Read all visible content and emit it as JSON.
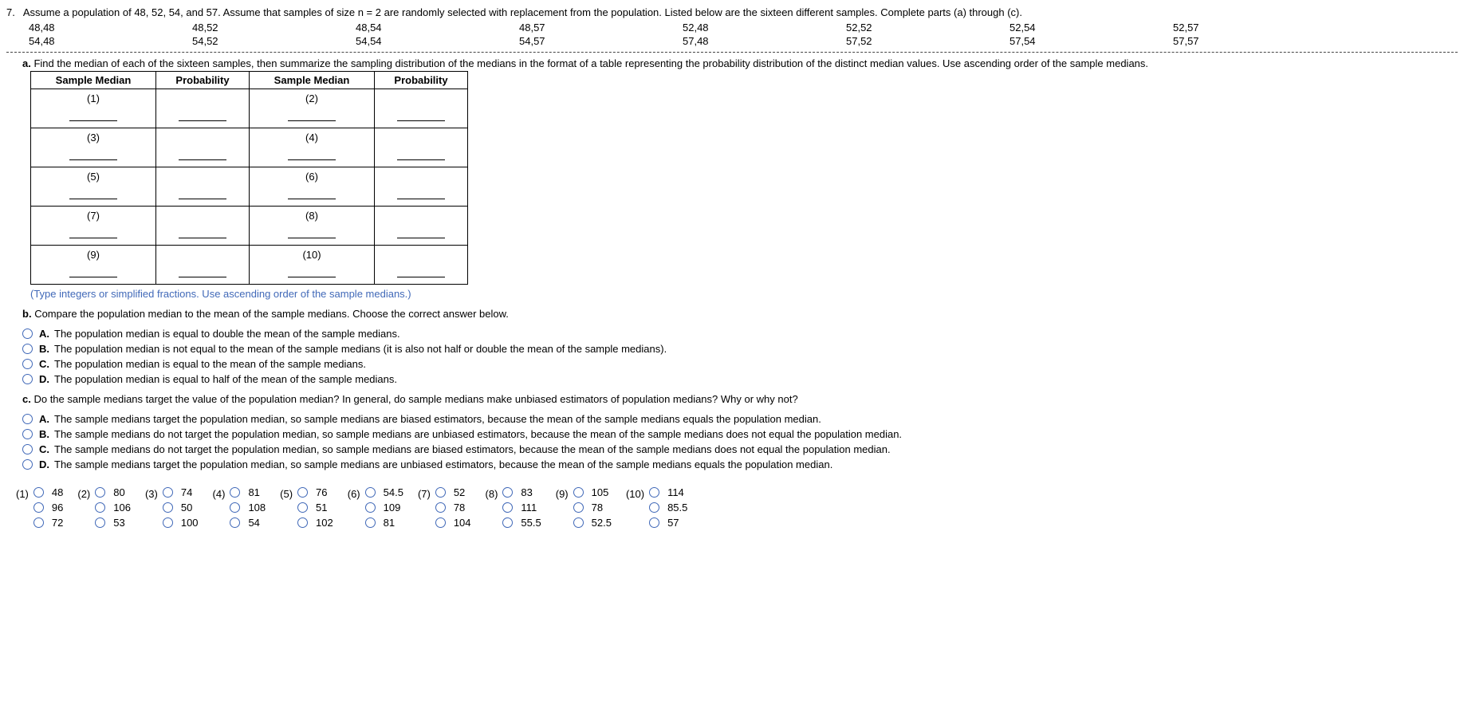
{
  "question": {
    "number": "7.",
    "intro": "Assume a population of 48, 52, 54, and 57. Assume that samples of size n = 2 are randomly selected with replacement from the population. Listed below are the sixteen different samples. Complete parts (a) through (c)."
  },
  "samples": {
    "row1": [
      "48,48",
      "48,52",
      "48,54",
      "48,57",
      "52,48",
      "52,52",
      "52,54",
      "52,57"
    ],
    "row2": [
      "54,48",
      "54,52",
      "54,54",
      "54,57",
      "57,48",
      "57,52",
      "57,54",
      "57,57"
    ]
  },
  "partA": {
    "label": "a.",
    "text": "Find the median of each of the sixteen samples, then summarize the sampling distribution of the medians in the format of a table representing the probability distribution of the distinct median values. Use ascending order of the sample medians.",
    "headers": [
      "Sample Median",
      "Probability",
      "Sample Median",
      "Probability"
    ],
    "rows": [
      "(1)",
      "(2)",
      "(3)",
      "(4)",
      "(5)",
      "(6)",
      "(7)",
      "(8)",
      "(9)",
      "(10)"
    ],
    "note": "(Type integers or simplified fractions. Use ascending order of the sample medians.)"
  },
  "partB": {
    "label": "b.",
    "text": "Compare the population median to the mean of the sample medians. Choose the correct answer below.",
    "options": [
      {
        "label": "A.",
        "text": "The population median is equal to double the mean of the sample medians."
      },
      {
        "label": "B.",
        "text": "The population median is not equal to the mean of the sample medians (it is also not half or double the mean of the sample medians)."
      },
      {
        "label": "C.",
        "text": "The population median is equal to the mean of the sample medians."
      },
      {
        "label": "D.",
        "text": "The population median is equal to half of the mean of the sample medians."
      }
    ]
  },
  "partC": {
    "label": "c.",
    "text": "Do the sample medians target the value of the population median? In general, do sample medians make unbiased estimators of population medians? Why or why not?",
    "options": [
      {
        "label": "A.",
        "text": "The sample medians target the population median, so sample medians are biased estimators, because the mean of the sample medians equals the population median."
      },
      {
        "label": "B.",
        "text": "The sample medians do not target the population median, so sample medians are unbiased estimators, because the mean of the sample medians does not equal the population median."
      },
      {
        "label": "C.",
        "text": "The sample medians do not target the population median, so sample medians are biased estimators, because the mean of the sample medians does not equal the population median."
      },
      {
        "label": "D.",
        "text": "The sample medians target the population median, so sample medians are unbiased estimators, because the mean of the sample medians equals the population median."
      }
    ]
  },
  "answers": [
    {
      "num": "(1)",
      "opts": [
        "48",
        "96",
        "72"
      ]
    },
    {
      "num": "(2)",
      "opts": [
        "80",
        "106",
        "53"
      ]
    },
    {
      "num": "(3)",
      "opts": [
        "74",
        "50",
        "100"
      ]
    },
    {
      "num": "(4)",
      "opts": [
        "81",
        "108",
        "54"
      ]
    },
    {
      "num": "(5)",
      "opts": [
        "76",
        "51",
        "102"
      ]
    },
    {
      "num": "(6)",
      "opts": [
        "54.5",
        "109",
        "81"
      ]
    },
    {
      "num": "(7)",
      "opts": [
        "52",
        "78",
        "104"
      ]
    },
    {
      "num": "(8)",
      "opts": [
        "83",
        "111",
        "55.5"
      ]
    },
    {
      "num": "(9)",
      "opts": [
        "105",
        "78",
        "52.5"
      ]
    },
    {
      "num": "(10)",
      "opts": [
        "114",
        "85.5",
        "57"
      ]
    }
  ]
}
